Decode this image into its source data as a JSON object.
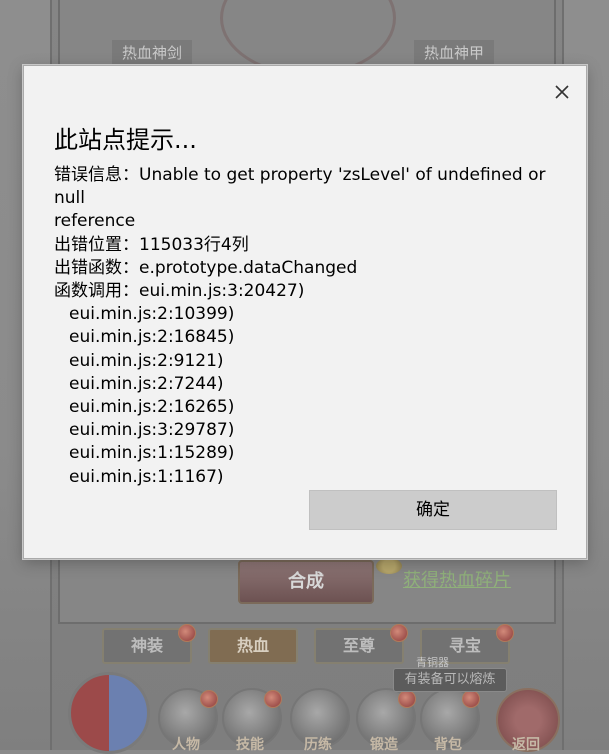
{
  "game": {
    "top_tabs": [
      "热血神剑",
      "热血神甲"
    ],
    "combine_label": "合成",
    "obtain_link": "获得热血碎片",
    "sub_tabs": [
      "神装",
      "热血",
      "至尊",
      "寻宝"
    ],
    "tip_title": "青铜器",
    "tip_text": "有装备可以熔炼",
    "menu": [
      "人物",
      "技能",
      "历练",
      "锻造",
      "背包"
    ],
    "back_label": "返回"
  },
  "dialog": {
    "title": "此站点提示...",
    "close_icon": "close-icon",
    "lines": [
      "错误信息：Unable to get property 'zsLevel' of undefined or null",
      "reference",
      "出错位置：115033行4列",
      "出错函数：e.prototype.dataChanged",
      "函数调用：eui.min.js:3:20427)"
    ],
    "stack": [
      "eui.min.js:2:10399)",
      "eui.min.js:2:16845)",
      "eui.min.js:2:9121)",
      "eui.min.js:2:7244)",
      "eui.min.js:2:16265)",
      "eui.min.js:3:29787)",
      "eui.min.js:1:15289)",
      "eui.min.js:1:1167)"
    ],
    "ok_label": "确定"
  },
  "colors": {
    "dialog_bg": "#f2f2f2",
    "button_bg": "#cccccc",
    "overlay": "#8a8a8a"
  }
}
